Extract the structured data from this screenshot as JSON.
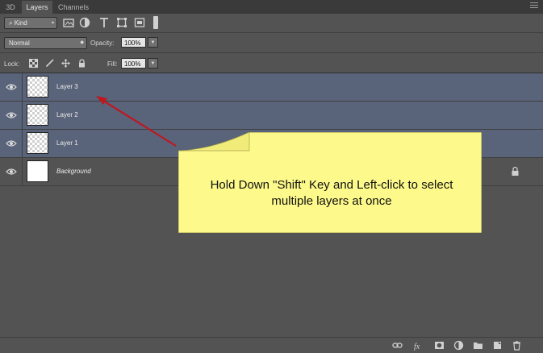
{
  "tabs": [
    {
      "label": "3D"
    },
    {
      "label": "Layers"
    },
    {
      "label": "Channels"
    }
  ],
  "filter": {
    "kind_label": "Kind"
  },
  "blend": {
    "mode": "Normal",
    "opacity_label": "Opacity:",
    "opacity_value": "100%"
  },
  "lock": {
    "label": "Lock:",
    "fill_label": "Fill:",
    "fill_value": "100%"
  },
  "layers": [
    {
      "name": "Layer 3",
      "selected": true
    },
    {
      "name": "Layer 2",
      "selected": true
    },
    {
      "name": "Layer 1",
      "selected": true
    },
    {
      "name": "Background",
      "selected": false
    }
  ],
  "callout": {
    "line1": "Hold Down \"Shift\" Key and Left-click to select",
    "line2": "multiple layers at once"
  },
  "colors": {
    "selected_row": "#59637a",
    "callout_fill": "#fdf98a",
    "arrow": "#c0171f",
    "panel": "#535353"
  }
}
